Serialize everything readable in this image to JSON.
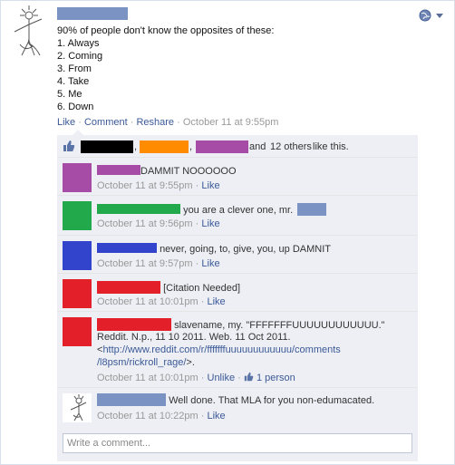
{
  "post": {
    "lines": [
      "90% of people don't know the opposites of these:",
      "1. Always",
      "2. Coming",
      "3. From",
      "4. Take",
      "5. Me",
      "6. Down"
    ],
    "actions": {
      "like": "Like",
      "comment": "Comment",
      "reshare": "Reshare",
      "sep": "·",
      "timestamp": "October 11 at 9:55pm"
    },
    "menu_icon": "globe-icon"
  },
  "likes": {
    "icon": "thumbs-up-icon",
    "comma": ",",
    "and_text": "and",
    "others_link": "12 others",
    "suffix": "like this.",
    "redaction_colors": [
      "#000000",
      "#ff8c00",
      "#a64ca6"
    ]
  },
  "comments": [
    {
      "text": "DAMMIT NOOOOOO",
      "time": "October 11 at 9:55pm",
      "like": "Like",
      "avatar_color": "#a64ca6",
      "name_color": "#a64ca6"
    },
    {
      "text": "you are a clever one, mr.",
      "time": "October 11 at 9:56pm",
      "like": "Like",
      "avatar_color": "#22a94c",
      "name_color": "#22a94c",
      "tail_color": "#7b93c2"
    },
    {
      "text": "never, going, to, give, you, up DAMNIT",
      "time": "October 11 at 9:57pm",
      "like": "Like",
      "avatar_color": "#3344cc",
      "name_color": "#3344cc"
    },
    {
      "text": "[Citation Needed]",
      "time": "October 11 at 10:01pm",
      "like": "Like",
      "avatar_color": "#e3202a",
      "name_color": "#e3202a"
    },
    {
      "text": "slavename, my. \"FFFFFFFUUUUUUUUUUUU.\"",
      "line2": "Reddit. N.p., 11 10 2011. Web. 11 Oct 2011.",
      "line3_pre": "<",
      "url1": "http://www.reddit.com/r/fffffffuuuuuuuuuuuu/comments",
      "url2": "/l8psm/rickroll_rage/",
      "line4_post": ">.",
      "time": "October 11 at 10:01pm",
      "unlike": "Unlike",
      "likes_count": "1 person",
      "avatar_color": "#e3202a",
      "name_color": "#e3202a"
    },
    {
      "text": "Well done. That MLA for you non-edumacated.",
      "time": "October 11 at 10:22pm",
      "like": "Like",
      "name_color": "#7b93c2"
    }
  ],
  "comment_input": {
    "placeholder": "Write a comment..."
  }
}
